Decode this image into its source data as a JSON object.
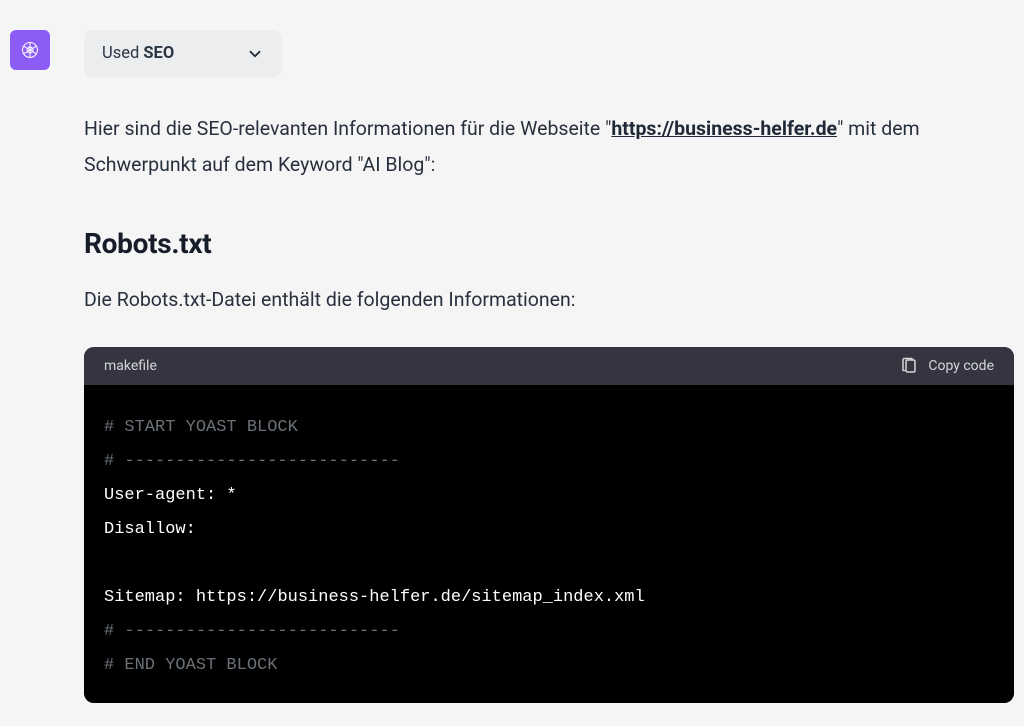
{
  "plugin": {
    "used_label": "Used",
    "name": "SEO"
  },
  "intro": {
    "prefix": "Hier sind die SEO-relevanten Informationen für die Webseite \"",
    "url": "https://business-helfer.de",
    "suffix": "\" mit dem Schwerpunkt auf dem Keyword \"AI Blog\":"
  },
  "section": {
    "title": "Robots.txt",
    "description": "Die Robots.txt-Datei enthält die folgenden Informationen:"
  },
  "code": {
    "language": "makefile",
    "copy_label": "Copy code",
    "lines": {
      "l1": "# START YOAST BLOCK",
      "l2": "# ---------------------------",
      "l3a": "User-agent: ",
      "l3b": "*",
      "l4a": "Disallow:",
      "blank": "",
      "l5a": "Sitemap: ",
      "l5b": "https://business-helfer.de/sitemap_index.xml",
      "l6": "# ---------------------------",
      "l7": "# END YOAST BLOCK"
    }
  }
}
